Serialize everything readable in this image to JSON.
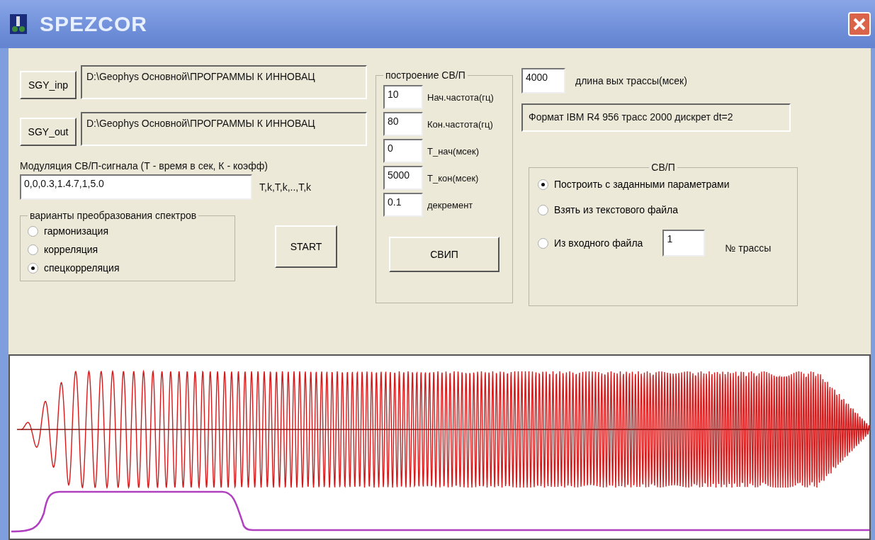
{
  "window": {
    "title": "SPEZCOR"
  },
  "files": [
    {
      "button": "SGY_inp",
      "path": "D:\\Geophys Основной\\ПРОГРАММЫ К ИННОВАЦ"
    },
    {
      "button": "SGY_out",
      "path": "D:\\Geophys Основной\\ПРОГРАММЫ К ИННОВАЦ"
    }
  ],
  "modulation": {
    "label": "Модуляция СВ/П-сигнала (Т - время в сек, К - коэфф)",
    "value": "0,0,0.3,1.4.7,1,5.0",
    "hint": "T,k,T,k,..,T,k"
  },
  "transform_group": {
    "title": "варианты преобразования спектров",
    "options": [
      {
        "label": "гармонизация",
        "selected": false
      },
      {
        "label": "корреляция",
        "selected": false
      },
      {
        "label": "спецкорреляция",
        "selected": true
      }
    ]
  },
  "start_button": "START",
  "sweep_group": {
    "title": "построение СВ/П",
    "fields": [
      {
        "value": "10",
        "label": "Нач.частота(гц)"
      },
      {
        "value": "80",
        "label": "Кон.частота(гц)"
      },
      {
        "value": "0",
        "label": "T_нач(мсек)"
      },
      {
        "value": "5000",
        "label": "T_кон(мсек)"
      },
      {
        "value": "0.1",
        "label": "декремент"
      }
    ],
    "button": "СВИП"
  },
  "trace_length": {
    "value": "4000",
    "label": "длина вых трассы(мсек)"
  },
  "format_info": "Формат IBM R4 956 трасс 2000 дискрет dt=2",
  "source_group": {
    "title": "СВ/П",
    "options": [
      {
        "label": "Построить с заданными параметрами",
        "selected": true
      },
      {
        "label": "Взять из текстового файла",
        "selected": false
      },
      {
        "label": "Из входного файла",
        "selected": false
      }
    ],
    "trace_number": "1",
    "trace_label": "№ трассы"
  }
}
